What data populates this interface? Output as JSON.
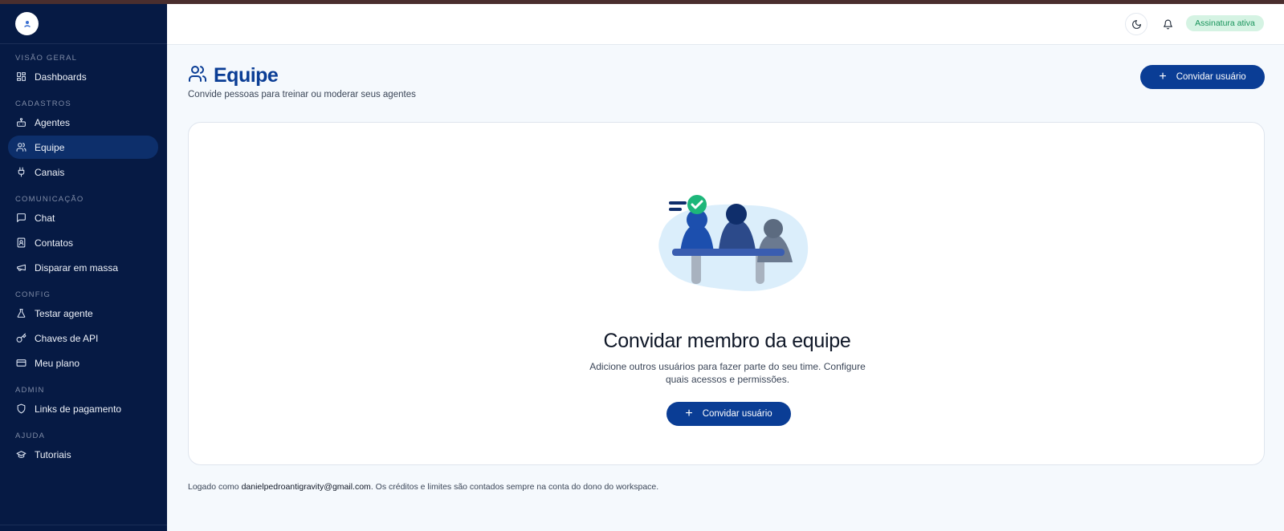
{
  "sidebar": {
    "sections": [
      {
        "label": "VISÃO GERAL",
        "items": [
          {
            "label": "Dashboards",
            "icon": "grid-icon"
          }
        ]
      },
      {
        "label": "CADASTROS",
        "items": [
          {
            "label": "Agentes",
            "icon": "bot-icon"
          },
          {
            "label": "Equipe",
            "icon": "users-icon",
            "active": true
          },
          {
            "label": "Canais",
            "icon": "plug-icon"
          }
        ]
      },
      {
        "label": "COMUNICAÇÃO",
        "items": [
          {
            "label": "Chat",
            "icon": "chat-icon"
          },
          {
            "label": "Contatos",
            "icon": "contact-icon"
          },
          {
            "label": "Disparar em massa",
            "icon": "megaphone-icon"
          }
        ]
      },
      {
        "label": "CONFIG",
        "items": [
          {
            "label": "Testar agente",
            "icon": "flask-icon"
          },
          {
            "label": "Chaves de API",
            "icon": "key-icon"
          },
          {
            "label": "Meu plano",
            "icon": "card-icon"
          }
        ]
      },
      {
        "label": "ADMIN",
        "items": [
          {
            "label": "Links de pagamento",
            "icon": "shield-icon"
          }
        ]
      },
      {
        "label": "AJUDA",
        "items": [
          {
            "label": "Tutoriais",
            "icon": "graduation-cap-icon"
          }
        ]
      }
    ]
  },
  "topbar": {
    "badge": "Assinatura ativa",
    "badge_color": "#17935a"
  },
  "page": {
    "title": "Equipe",
    "subtitle": "Convide pessoas para treinar ou moderar seus agentes",
    "invite_button": "Convidar usuário"
  },
  "empty_state": {
    "title": "Convidar membro da equipe",
    "description": "Adicione outros usuários para fazer parte do seu time. Configure quais acessos e permissões.",
    "button": "Convidar usuário"
  },
  "footer": {
    "prefix": "Logado como ",
    "email": "danielpedroantigravity@gmail.com",
    "suffix": ". Os créditos e limites são contados sempre na conta do dono do workspace."
  },
  "colors": {
    "sidebar_bg": "#061a44",
    "primary": "#0a3d95",
    "page_bg": "#f5f9fd"
  }
}
